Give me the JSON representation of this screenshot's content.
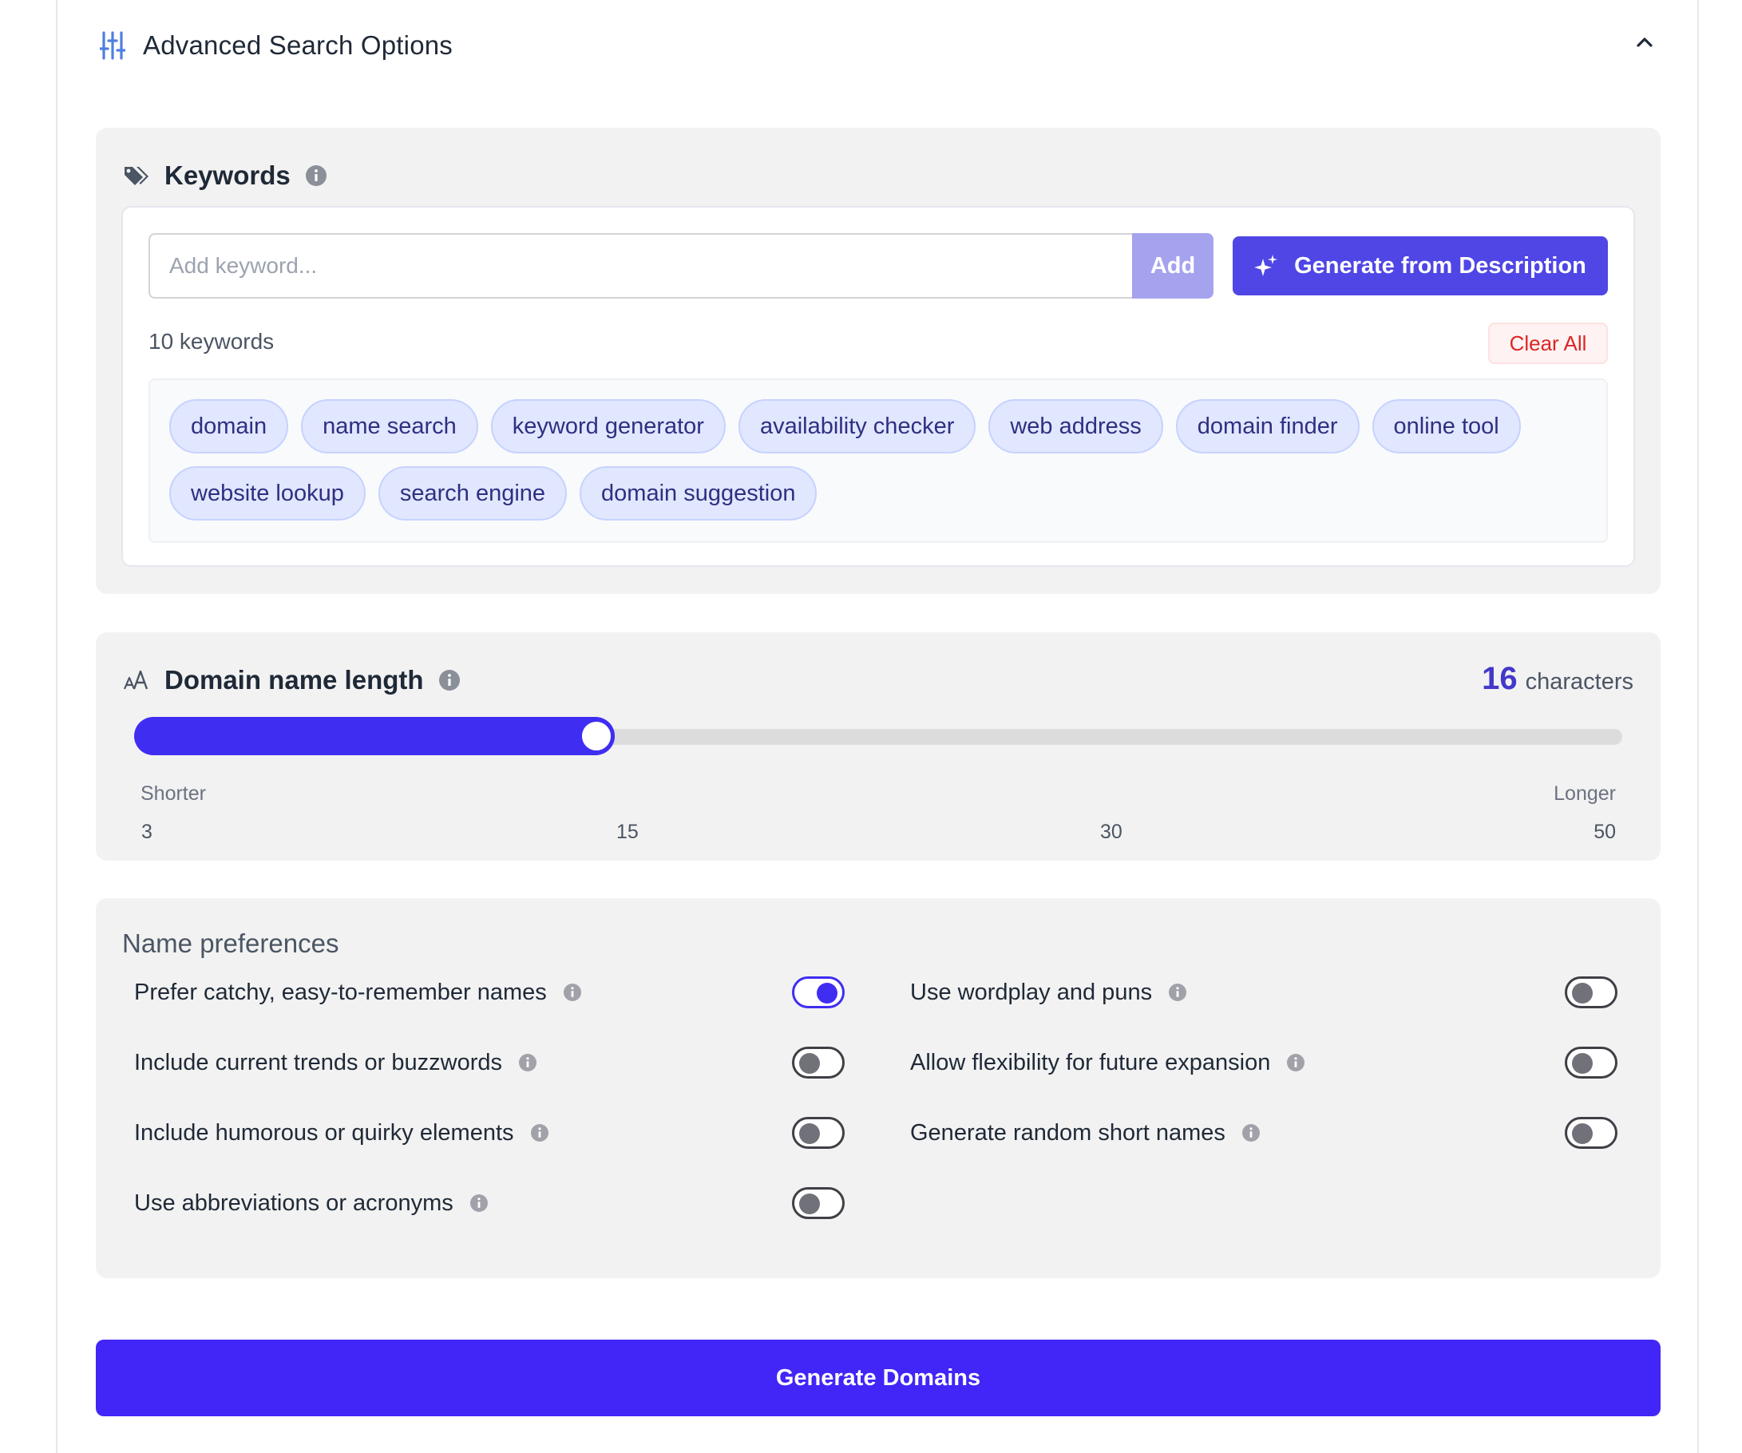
{
  "header": {
    "title": "Advanced Search Options"
  },
  "keywords": {
    "title": "Keywords",
    "input_placeholder": "Add keyword...",
    "add_label": "Add",
    "generate_label": "Generate from Description",
    "count_text": "10 keywords",
    "clear_label": "Clear All",
    "items": [
      "domain",
      "name search",
      "keyword generator",
      "availability checker",
      "web address",
      "domain finder",
      "online tool",
      "website lookup",
      "search engine",
      "domain suggestion"
    ]
  },
  "length": {
    "title": "Domain name length",
    "value": "16",
    "unit": "characters",
    "min": 3,
    "max": 50,
    "current": 16,
    "shorter_label": "Shorter",
    "longer_label": "Longer",
    "ticks": [
      "3",
      "15",
      "30",
      "50"
    ]
  },
  "preferences": {
    "title": "Name preferences",
    "left": [
      {
        "label": "Prefer catchy, easy-to-remember names",
        "on": true
      },
      {
        "label": "Include current trends or buzzwords",
        "on": false
      },
      {
        "label": "Include humorous or quirky elements",
        "on": false
      },
      {
        "label": "Use abbreviations or acronyms",
        "on": false
      }
    ],
    "right": [
      {
        "label": "Use wordplay and puns",
        "on": false
      },
      {
        "label": "Allow flexibility for future expansion",
        "on": false
      },
      {
        "label": "Generate random short names",
        "on": false
      }
    ]
  },
  "generate_button": "Generate Domains",
  "colors": {
    "accent": "#3f2df2",
    "chip_bg": "#e0e7ff",
    "danger": "#dc2626"
  }
}
